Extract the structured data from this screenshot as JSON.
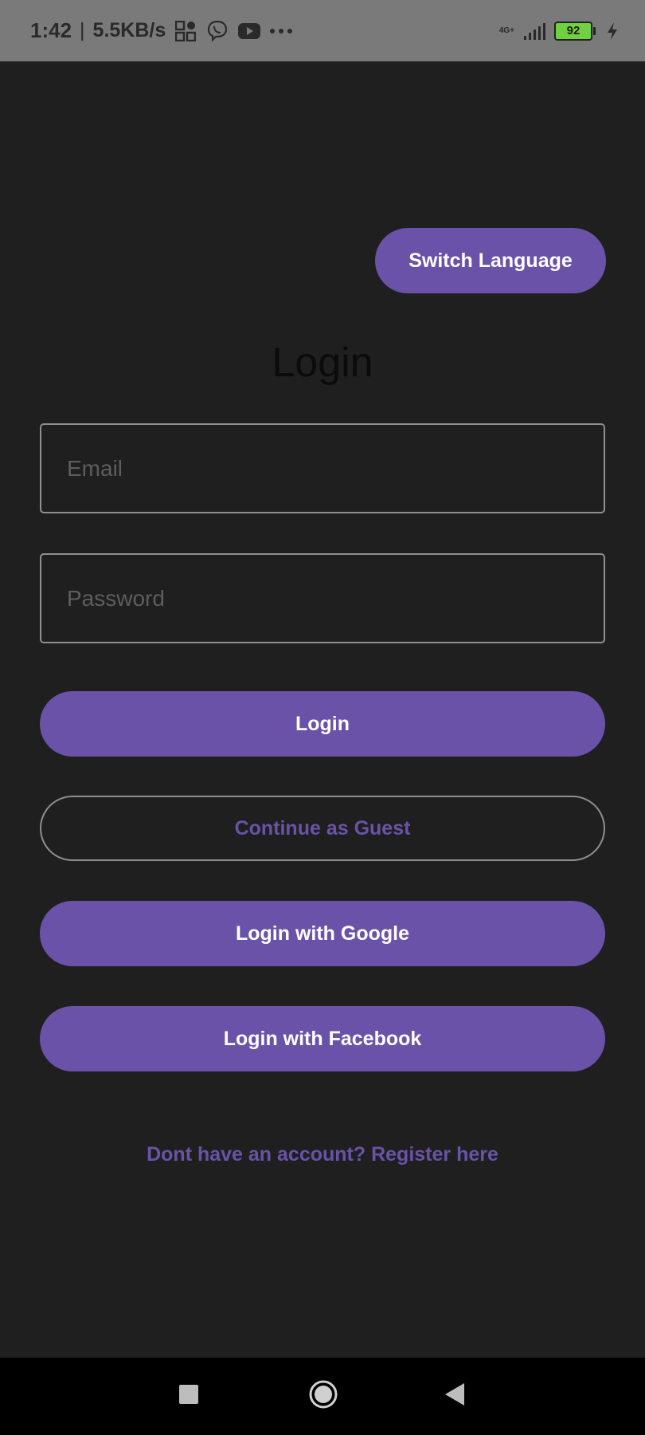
{
  "status_bar": {
    "time": "1:42",
    "separator": "|",
    "net_speed": "5.5KB/s",
    "network_type": "4G+",
    "battery_level": "92",
    "icons": [
      "apps-grid-icon",
      "viber-icon",
      "youtube-icon",
      "more-dots-icon",
      "signal-icon",
      "battery-icon",
      "charging-icon"
    ]
  },
  "header": {
    "switch_language_label": "Switch Language"
  },
  "login_form": {
    "title": "Login",
    "email_placeholder": "Email",
    "password_placeholder": "Password",
    "login_label": "Login",
    "guest_label": "Continue as Guest",
    "google_label": "Login with Google",
    "facebook_label": "Login with Facebook",
    "register_text": "Dont have an account? Register here"
  },
  "nav_bar": {
    "icons": [
      "recent-apps-icon",
      "home-icon",
      "back-icon"
    ]
  },
  "colors": {
    "background": "#1f1f1f",
    "accent": "#6a52a8",
    "status_bar": "#7a7a7a",
    "outline": "#8f8f8f"
  }
}
